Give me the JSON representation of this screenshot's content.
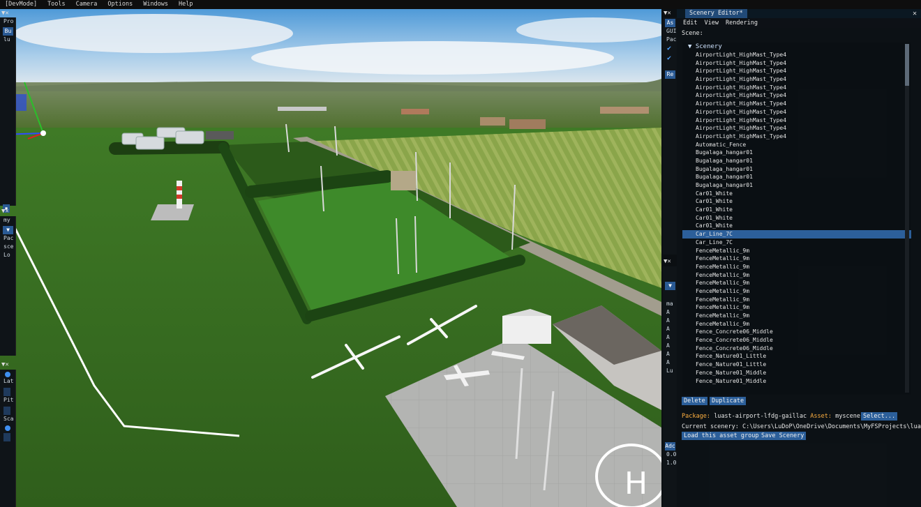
{
  "menubar": [
    "[DevMode]",
    "Tools",
    "Camera",
    "Options",
    "Windows",
    "Help"
  ],
  "left_panels": {
    "top": {
      "labels": [
        "Pro"
      ],
      "buttons": [
        "Bu",
        "lu"
      ]
    },
    "middle": {
      "labels": [
        "my",
        "Pac",
        "sce",
        "Lo"
      ]
    },
    "bottom": {
      "labels": [
        "Lat",
        "Pit",
        "Sca"
      ]
    }
  },
  "right_strip": {
    "top": {
      "button": "As",
      "labels": [
        "GUI",
        "Pac"
      ],
      "button2": "Re"
    },
    "bottom": {
      "labels": [
        "ma",
        "A",
        "A",
        "A",
        "A",
        "A",
        "A",
        "A",
        "Lu"
      ],
      "button": "Adc",
      "labels2": [
        "0.0",
        "1.0"
      ]
    }
  },
  "editor": {
    "title": "Scenery Editor*",
    "menu": [
      "Edit",
      "View",
      "Rendering"
    ],
    "scene_label": "Scene:",
    "root_label": "Scenery",
    "items": [
      "AirportLight_HighMast_Type4",
      "AirportLight_HighMast_Type4",
      "AirportLight_HighMast_Type4",
      "AirportLight_HighMast_Type4",
      "AirportLight_HighMast_Type4",
      "AirportLight_HighMast_Type4",
      "AirportLight_HighMast_Type4",
      "AirportLight_HighMast_Type4",
      "AirportLight_HighMast_Type4",
      "AirportLight_HighMast_Type4",
      "AirportLight_HighMast_Type4",
      "Automatic_Fence",
      "Bugalaga_hangar01",
      "Bugalaga_hangar01",
      "Bugalaga_hangar01",
      "Bugalaga_hangar01",
      "Bugalaga_hangar01",
      "Car01_White",
      "Car01_White",
      "Car01_White",
      "Car01_White",
      "Car01_White",
      "Car_Line_7C",
      "Car_Line_7C",
      "FenceMetallic_9m",
      "FenceMetallic_9m",
      "FenceMetallic_9m",
      "FenceMetallic_9m",
      "FenceMetallic_9m",
      "FenceMetallic_9m",
      "FenceMetallic_9m",
      "FenceMetallic_9m",
      "FenceMetallic_9m",
      "FenceMetallic_9m",
      "Fence_Concrete06_Middle",
      "Fence_Concrete06_Middle",
      "Fence_Concrete06_Middle",
      "Fence_Nature01_Little",
      "Fence_Nature01_Little",
      "Fence_Nature01_Middle",
      "Fence_Nature01_Middle"
    ],
    "selected_index": 22,
    "delete_label": "Delete",
    "duplicate_label": "Duplicate",
    "package_key": "Package:",
    "package_value": "luast-airport-lfdg-gaillac",
    "asset_key": "Asset:",
    "asset_value": "myscene",
    "select_label": "Select...",
    "current_scenery": "Current scenery: C:\\Users\\LuDoP\\OneDrive\\Documents\\MyFSProjects\\luast-a",
    "load_label": "Load this asset group",
    "save_label": "Save Scenery"
  },
  "helipad_letter": "H"
}
